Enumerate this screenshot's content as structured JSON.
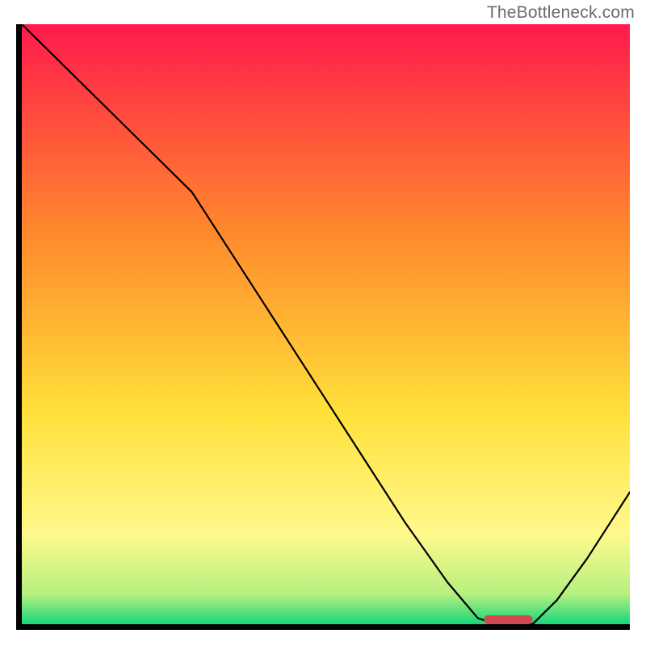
{
  "watermark": "TheBottleneck.com",
  "chart_data": {
    "type": "line",
    "title": "",
    "xlabel": "",
    "ylabel": "",
    "xlim": [
      0,
      100
    ],
    "ylim": [
      0,
      100
    ],
    "grid": false,
    "legend": false,
    "background_gradient": {
      "top": "#ff1a4c",
      "mid1": "#ff8a2c",
      "mid2": "#ffe13a",
      "mid3": "#fff98c",
      "mid4": "#b6f080",
      "bottom": "#17d67a"
    },
    "series": [
      {
        "name": "bottleneck-curve",
        "x": [
          0,
          7,
          14,
          21,
          28,
          35,
          42,
          49,
          56,
          63,
          70,
          75,
          78,
          81,
          84,
          88,
          93,
          100
        ],
        "y": [
          100,
          93,
          86,
          79,
          72,
          61,
          50,
          39,
          28,
          17,
          7,
          1,
          0,
          0,
          0,
          4,
          11,
          22
        ]
      }
    ],
    "marker": {
      "name": "selected-range",
      "shape": "pill",
      "x_center": 80,
      "y": 0,
      "width_x": 8
    }
  }
}
